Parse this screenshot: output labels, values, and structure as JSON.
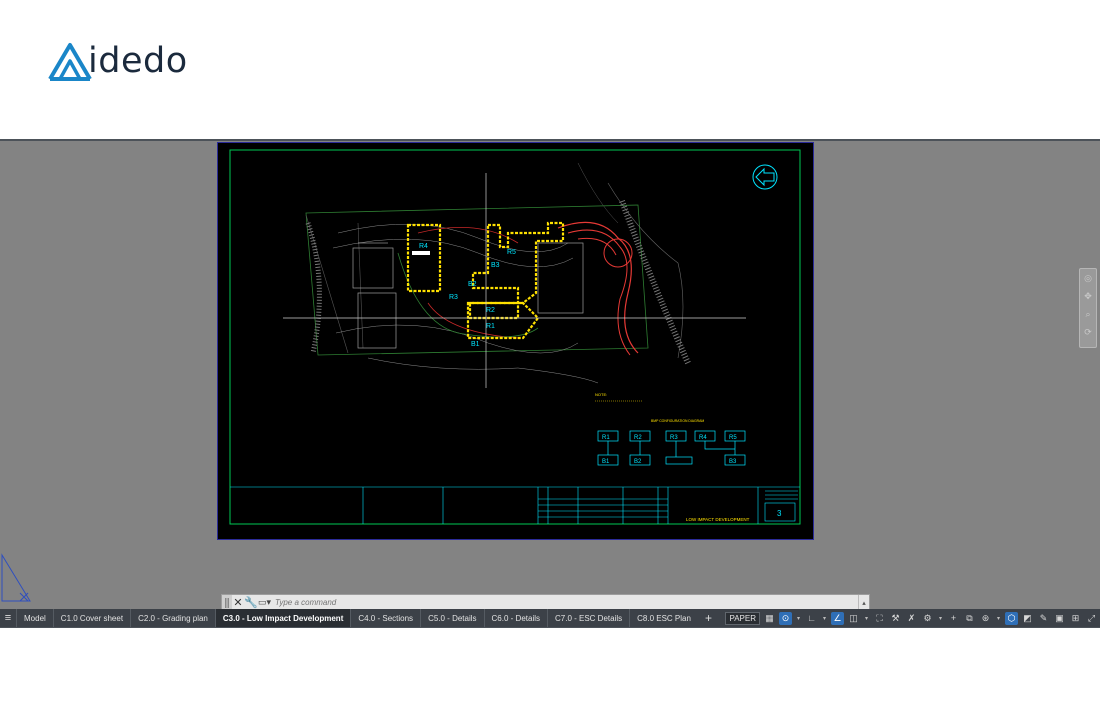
{
  "brand": {
    "name": "idedo",
    "accent": "#1a86c8"
  },
  "command": {
    "placeholder": "Type a command"
  },
  "tabs": [
    {
      "label": "Model",
      "active": false
    },
    {
      "label": "C1.0 Cover sheet",
      "active": false
    },
    {
      "label": "C2.0 - Grading plan",
      "active": false
    },
    {
      "label": "C3.0 - Low Impact Development",
      "active": true
    },
    {
      "label": "C4.0 - Sections",
      "active": false
    },
    {
      "label": "C5.0 - Details",
      "active": false
    },
    {
      "label": "C6.0 - Details",
      "active": false
    },
    {
      "label": "C7.0 - ESC Details",
      "active": false
    },
    {
      "label": "C8.0 ESC Plan",
      "active": false
    }
  ],
  "status": {
    "space": "PAPER"
  },
  "drawing": {
    "sheet_number": "3",
    "sheet_title": "LOW IMPACT DEVELOPMENT",
    "diagram_title": "BMP CONFIGURATION DIAGRAM",
    "roof_labels": [
      "R1",
      "R2",
      "R3",
      "R4",
      "R5"
    ],
    "bed_labels": [
      "B1",
      "B2",
      "B3"
    ],
    "plan_labels": [
      "R4",
      "R5",
      "B3",
      "B2",
      "R3",
      "R2",
      "R1",
      "B1"
    ],
    "note_label": "NOTE:"
  },
  "colors": {
    "viewport": "#838383",
    "sheet_border": "#00c853",
    "cyan": "#00e5ff",
    "yellow": "#ffe100",
    "red": "#e53935"
  }
}
